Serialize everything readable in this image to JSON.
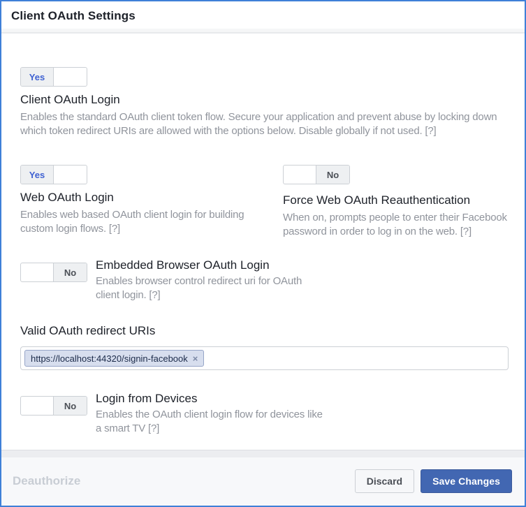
{
  "panel": {
    "title": "Client OAuth Settings"
  },
  "colors": {
    "panel-border": "#3f80d8",
    "toggle-yes": "#4062d2",
    "accent": "#4267b2",
    "chip-bg": "#d7deee",
    "chip-border": "#96a5c8"
  },
  "sections": {
    "client_oauth_login": {
      "toggle_value": "Yes",
      "title": "Client OAuth Login",
      "description": "Enables the standard OAuth client token flow. Secure your application and prevent abuse by locking down which token redirect URIs are allowed with the options below. Disable globally if not used.",
      "help_label": "[?]"
    },
    "web_oauth_login": {
      "toggle_value": "Yes",
      "title": "Web OAuth Login",
      "description": "Enables web based OAuth client login for building custom login flows.",
      "help_label": "[?]"
    },
    "force_web_oauth_reauthentication": {
      "toggle_value": "No",
      "title": "Force Web OAuth Reauthentication",
      "description": "When on, prompts people to enter their Facebook password in order to log in on the web.",
      "help_label": "[?]"
    },
    "embedded_browser_oauth_login": {
      "toggle_value": "No",
      "title": "Embedded Browser OAuth Login",
      "description": "Enables browser control redirect uri for OAuth client login.",
      "help_label": "[?]"
    },
    "valid_oauth_redirect_uris": {
      "label": "Valid OAuth redirect URIs",
      "tokens": [
        {
          "value": "https://localhost:44320/signin-facebook",
          "remove_label": "×"
        }
      ]
    },
    "login_from_devices": {
      "toggle_value": "No",
      "title": "Login from Devices",
      "description": "Enables the OAuth client login flow for devices like a smart TV",
      "help_label": "[?]"
    }
  },
  "footer": {
    "deauthorize_label": "Deauthorize",
    "discard_label": "Discard",
    "save_label": "Save Changes"
  }
}
